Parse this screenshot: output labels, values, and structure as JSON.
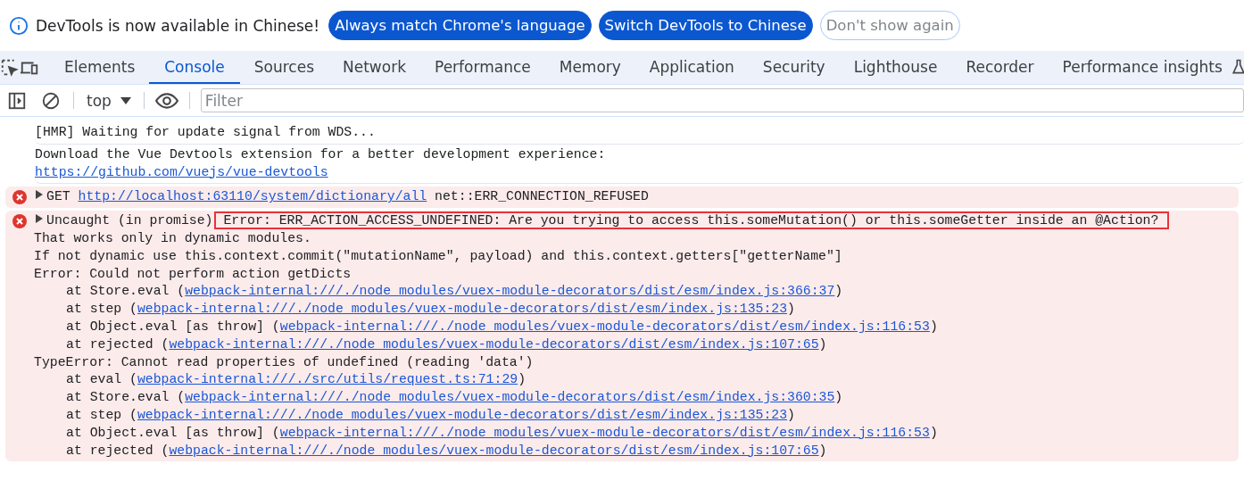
{
  "banner": {
    "message": "DevTools is now available in Chinese!",
    "buttons": [
      {
        "label": "Always match Chrome's language",
        "kind": "primary"
      },
      {
        "label": "Switch DevTools to Chinese",
        "kind": "primary"
      },
      {
        "label": "Don't show again",
        "kind": "outline"
      }
    ]
  },
  "tabs": [
    {
      "label": "Elements",
      "selected": false
    },
    {
      "label": "Console",
      "selected": true
    },
    {
      "label": "Sources",
      "selected": false
    },
    {
      "label": "Network",
      "selected": false
    },
    {
      "label": "Performance",
      "selected": false
    },
    {
      "label": "Memory",
      "selected": false
    },
    {
      "label": "Application",
      "selected": false
    },
    {
      "label": "Security",
      "selected": false
    },
    {
      "label": "Lighthouse",
      "selected": false
    },
    {
      "label": "Recorder",
      "selected": false
    },
    {
      "label": "Performance insights",
      "selected": false,
      "experimental": true
    }
  ],
  "toolbar": {
    "context": "top",
    "filter_placeholder": "Filter"
  },
  "messages": [
    {
      "kind": "log",
      "lines": [
        {
          "segments": [
            {
              "kind": "text",
              "text": "[HMR] Waiting for update signal from WDS..."
            }
          ]
        }
      ]
    },
    {
      "kind": "log",
      "lines": [
        {
          "segments": [
            {
              "kind": "text",
              "text": "Download the Vue Devtools extension for a better development experience:"
            }
          ]
        },
        {
          "segments": [
            {
              "kind": "link",
              "text": "https://github.com/vuejs/vue-devtools"
            }
          ]
        }
      ]
    },
    {
      "kind": "error",
      "lines": [
        {
          "segments": [
            {
              "kind": "text",
              "text": "GET "
            },
            {
              "kind": "link",
              "text": "http://localhost:63110/system/dictionary/all"
            },
            {
              "kind": "text",
              "text": " net::ERR_CONNECTION_REFUSED"
            }
          ]
        }
      ]
    },
    {
      "kind": "error",
      "lines": [
        {
          "segments": [
            {
              "kind": "text",
              "text": "Uncaught (in promise)"
            },
            {
              "kind": "highlight",
              "text": "Error: ERR_ACTION_ACCESS_UNDEFINED: Are you trying to access this.someMutation() or this.someGetter inside an @Action?"
            }
          ]
        },
        {
          "segments": [
            {
              "kind": "text",
              "text": "That works only in dynamic modules."
            }
          ]
        },
        {
          "segments": [
            {
              "kind": "text",
              "text": "If not dynamic use this.context.commit(\"mutationName\", payload) and this.context.getters[\"getterName\"]"
            }
          ]
        },
        {
          "segments": [
            {
              "kind": "text",
              "text": "Error: Could not perform action getDicts"
            }
          ]
        },
        {
          "frame": true,
          "segments": [
            {
              "kind": "text",
              "text": "at Store.eval ("
            },
            {
              "kind": "link",
              "text": "webpack-internal:///./node_modules/vuex-module-decorators/dist/esm/index.js:366:37"
            },
            {
              "kind": "text",
              "text": ")"
            }
          ]
        },
        {
          "frame": true,
          "segments": [
            {
              "kind": "text",
              "text": "at step ("
            },
            {
              "kind": "link",
              "text": "webpack-internal:///./node_modules/vuex-module-decorators/dist/esm/index.js:135:23"
            },
            {
              "kind": "text",
              "text": ")"
            }
          ]
        },
        {
          "frame": true,
          "segments": [
            {
              "kind": "text",
              "text": "at Object.eval [as throw] ("
            },
            {
              "kind": "link",
              "text": "webpack-internal:///./node_modules/vuex-module-decorators/dist/esm/index.js:116:53"
            },
            {
              "kind": "text",
              "text": ")"
            }
          ]
        },
        {
          "frame": true,
          "segments": [
            {
              "kind": "text",
              "text": "at rejected ("
            },
            {
              "kind": "link",
              "text": "webpack-internal:///./node_modules/vuex-module-decorators/dist/esm/index.js:107:65"
            },
            {
              "kind": "text",
              "text": ")"
            }
          ]
        },
        {
          "segments": [
            {
              "kind": "text",
              "text": "TypeError: Cannot read properties of undefined (reading 'data')"
            }
          ]
        },
        {
          "frame": true,
          "segments": [
            {
              "kind": "text",
              "text": "at eval ("
            },
            {
              "kind": "link",
              "text": "webpack-internal:///./src/utils/request.ts:71:29"
            },
            {
              "kind": "text",
              "text": ")"
            }
          ]
        },
        {
          "frame": true,
          "segments": [
            {
              "kind": "text",
              "text": "at Store.eval ("
            },
            {
              "kind": "link",
              "text": "webpack-internal:///./node_modules/vuex-module-decorators/dist/esm/index.js:360:35"
            },
            {
              "kind": "text",
              "text": ")"
            }
          ]
        },
        {
          "frame": true,
          "segments": [
            {
              "kind": "text",
              "text": "at step ("
            },
            {
              "kind": "link",
              "text": "webpack-internal:///./node_modules/vuex-module-decorators/dist/esm/index.js:135:23"
            },
            {
              "kind": "text",
              "text": ")"
            }
          ]
        },
        {
          "frame": true,
          "segments": [
            {
              "kind": "text",
              "text": "at Object.eval [as throw] ("
            },
            {
              "kind": "link",
              "text": "webpack-internal:///./node_modules/vuex-module-decorators/dist/esm/index.js:116:53"
            },
            {
              "kind": "text",
              "text": ")"
            }
          ]
        },
        {
          "frame": true,
          "segments": [
            {
              "kind": "text",
              "text": "at rejected ("
            },
            {
              "kind": "link",
              "text": "webpack-internal:///./node_modules/vuex-module-decorators/dist/esm/index.js:107:65"
            },
            {
              "kind": "text",
              "text": ")"
            }
          ]
        }
      ]
    }
  ]
}
